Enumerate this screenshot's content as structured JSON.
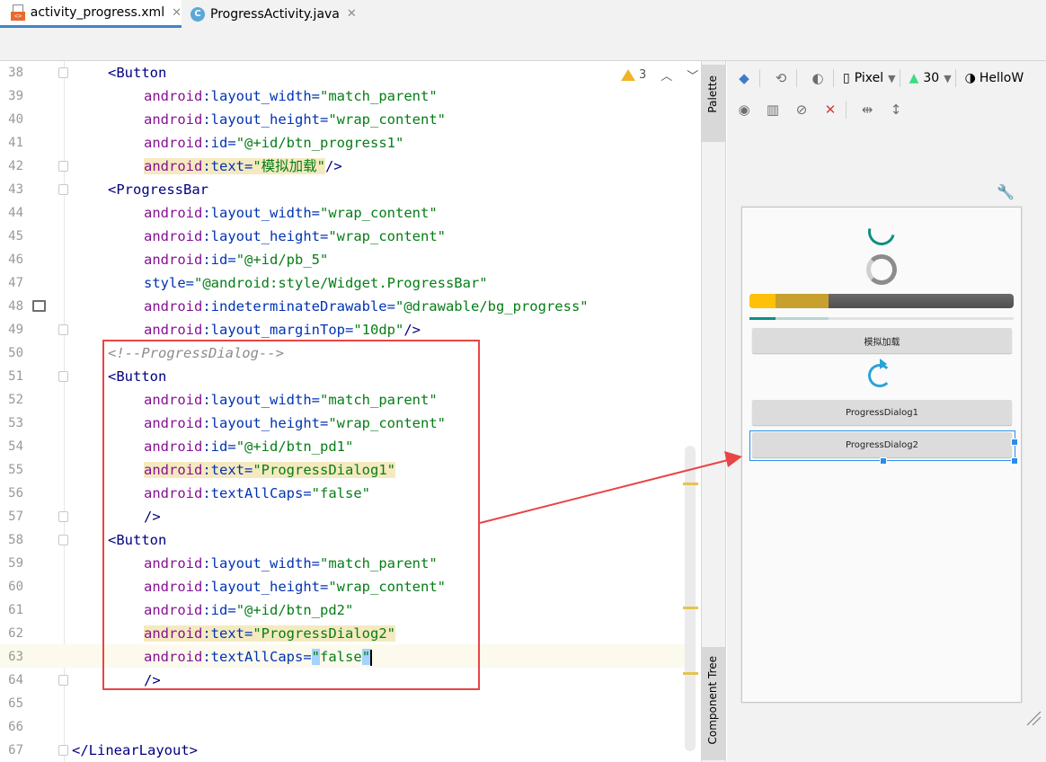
{
  "tabs": [
    {
      "label": "activity_progress.xml",
      "active": true,
      "icon": "xml-file-icon"
    },
    {
      "label": "ProgressActivity.java",
      "active": false,
      "icon": "java-class-icon"
    }
  ],
  "editor": {
    "warnings_count": "3",
    "lines": [
      {
        "n": "38"
      },
      {
        "n": "39"
      },
      {
        "n": "40"
      },
      {
        "n": "41"
      },
      {
        "n": "42"
      },
      {
        "n": "43"
      },
      {
        "n": "44"
      },
      {
        "n": "45"
      },
      {
        "n": "46"
      },
      {
        "n": "47"
      },
      {
        "n": "48"
      },
      {
        "n": "49"
      },
      {
        "n": "50"
      },
      {
        "n": "51"
      },
      {
        "n": "52"
      },
      {
        "n": "53"
      },
      {
        "n": "54"
      },
      {
        "n": "55"
      },
      {
        "n": "56"
      },
      {
        "n": "57"
      },
      {
        "n": "58"
      },
      {
        "n": "59"
      },
      {
        "n": "60"
      },
      {
        "n": "61"
      },
      {
        "n": "62"
      },
      {
        "n": "63"
      },
      {
        "n": "64"
      },
      {
        "n": "65"
      },
      {
        "n": "66"
      },
      {
        "n": "67"
      }
    ],
    "code": {
      "l38": "<Button",
      "l39_attr": "layout_width",
      "l39_val": "\"match_parent\"",
      "l40_attr": "layout_height",
      "l40_val": "\"wrap_content\"",
      "l41_attr": "id",
      "l41_val": "\"@+id/btn_progress1\"",
      "l42_attr": "text",
      "l42_val": "\"模拟加载\"",
      "l43": "<ProgressBar",
      "l44_attr": "layout_width",
      "l44_val": "\"wrap_content\"",
      "l45_attr": "layout_height",
      "l45_val": "\"wrap_content\"",
      "l46_attr": "id",
      "l46_val": "\"@+id/pb_5\"",
      "l47_attr": "style",
      "l47_val": "\"@android:style/Widget.ProgressBar\"",
      "l48_attr": "indeterminateDrawable",
      "l48_val": "\"@drawable/bg_progress\"",
      "l49_attr": "layout_marginTop",
      "l49_val": "\"10dp\"",
      "l50": "<!--ProgressDialog-->",
      "l51": "<Button",
      "l52_attr": "layout_width",
      "l52_val": "\"match_parent\"",
      "l53_attr": "layout_height",
      "l53_val": "\"wrap_content\"",
      "l54_attr": "id",
      "l54_val": "\"@+id/btn_pd1\"",
      "l55_attr": "text",
      "l55_val": "\"ProgressDialog1\"",
      "l56_attr": "textAllCaps",
      "l56_val": "\"false\"",
      "l57": "/>",
      "l58": "<Button",
      "l59_attr": "layout_width",
      "l59_val": "\"match_parent\"",
      "l60_attr": "layout_height",
      "l60_val": "\"wrap_content\"",
      "l61_attr": "id",
      "l61_val": "\"@+id/btn_pd2\"",
      "l62_attr": "text",
      "l62_val": "\"ProgressDialog2\"",
      "l63_attr": "textAllCaps",
      "l63_val": "false",
      "l64": "/>",
      "l67": "</LinearLayout>"
    },
    "ns_prefix": "android",
    "tag_close": "/>"
  },
  "side_tabs": {
    "palette": "Palette",
    "component_tree": "Component Tree"
  },
  "design": {
    "device_label": "Pixel",
    "api_level": "30",
    "theme_label": "HelloW",
    "preview": {
      "btn_progress1": "模拟加载",
      "btn_pd1": "ProgressDialog1",
      "btn_pd2": "ProgressDialog2",
      "progress_primary": 0.1,
      "progress_secondary": 0.3,
      "hbar_primary": 0.1,
      "hbar_secondary": 0.3
    }
  },
  "colors": {
    "annotation": "#e84545",
    "selection": "#2d8de8",
    "accent": "#0f8f80"
  }
}
